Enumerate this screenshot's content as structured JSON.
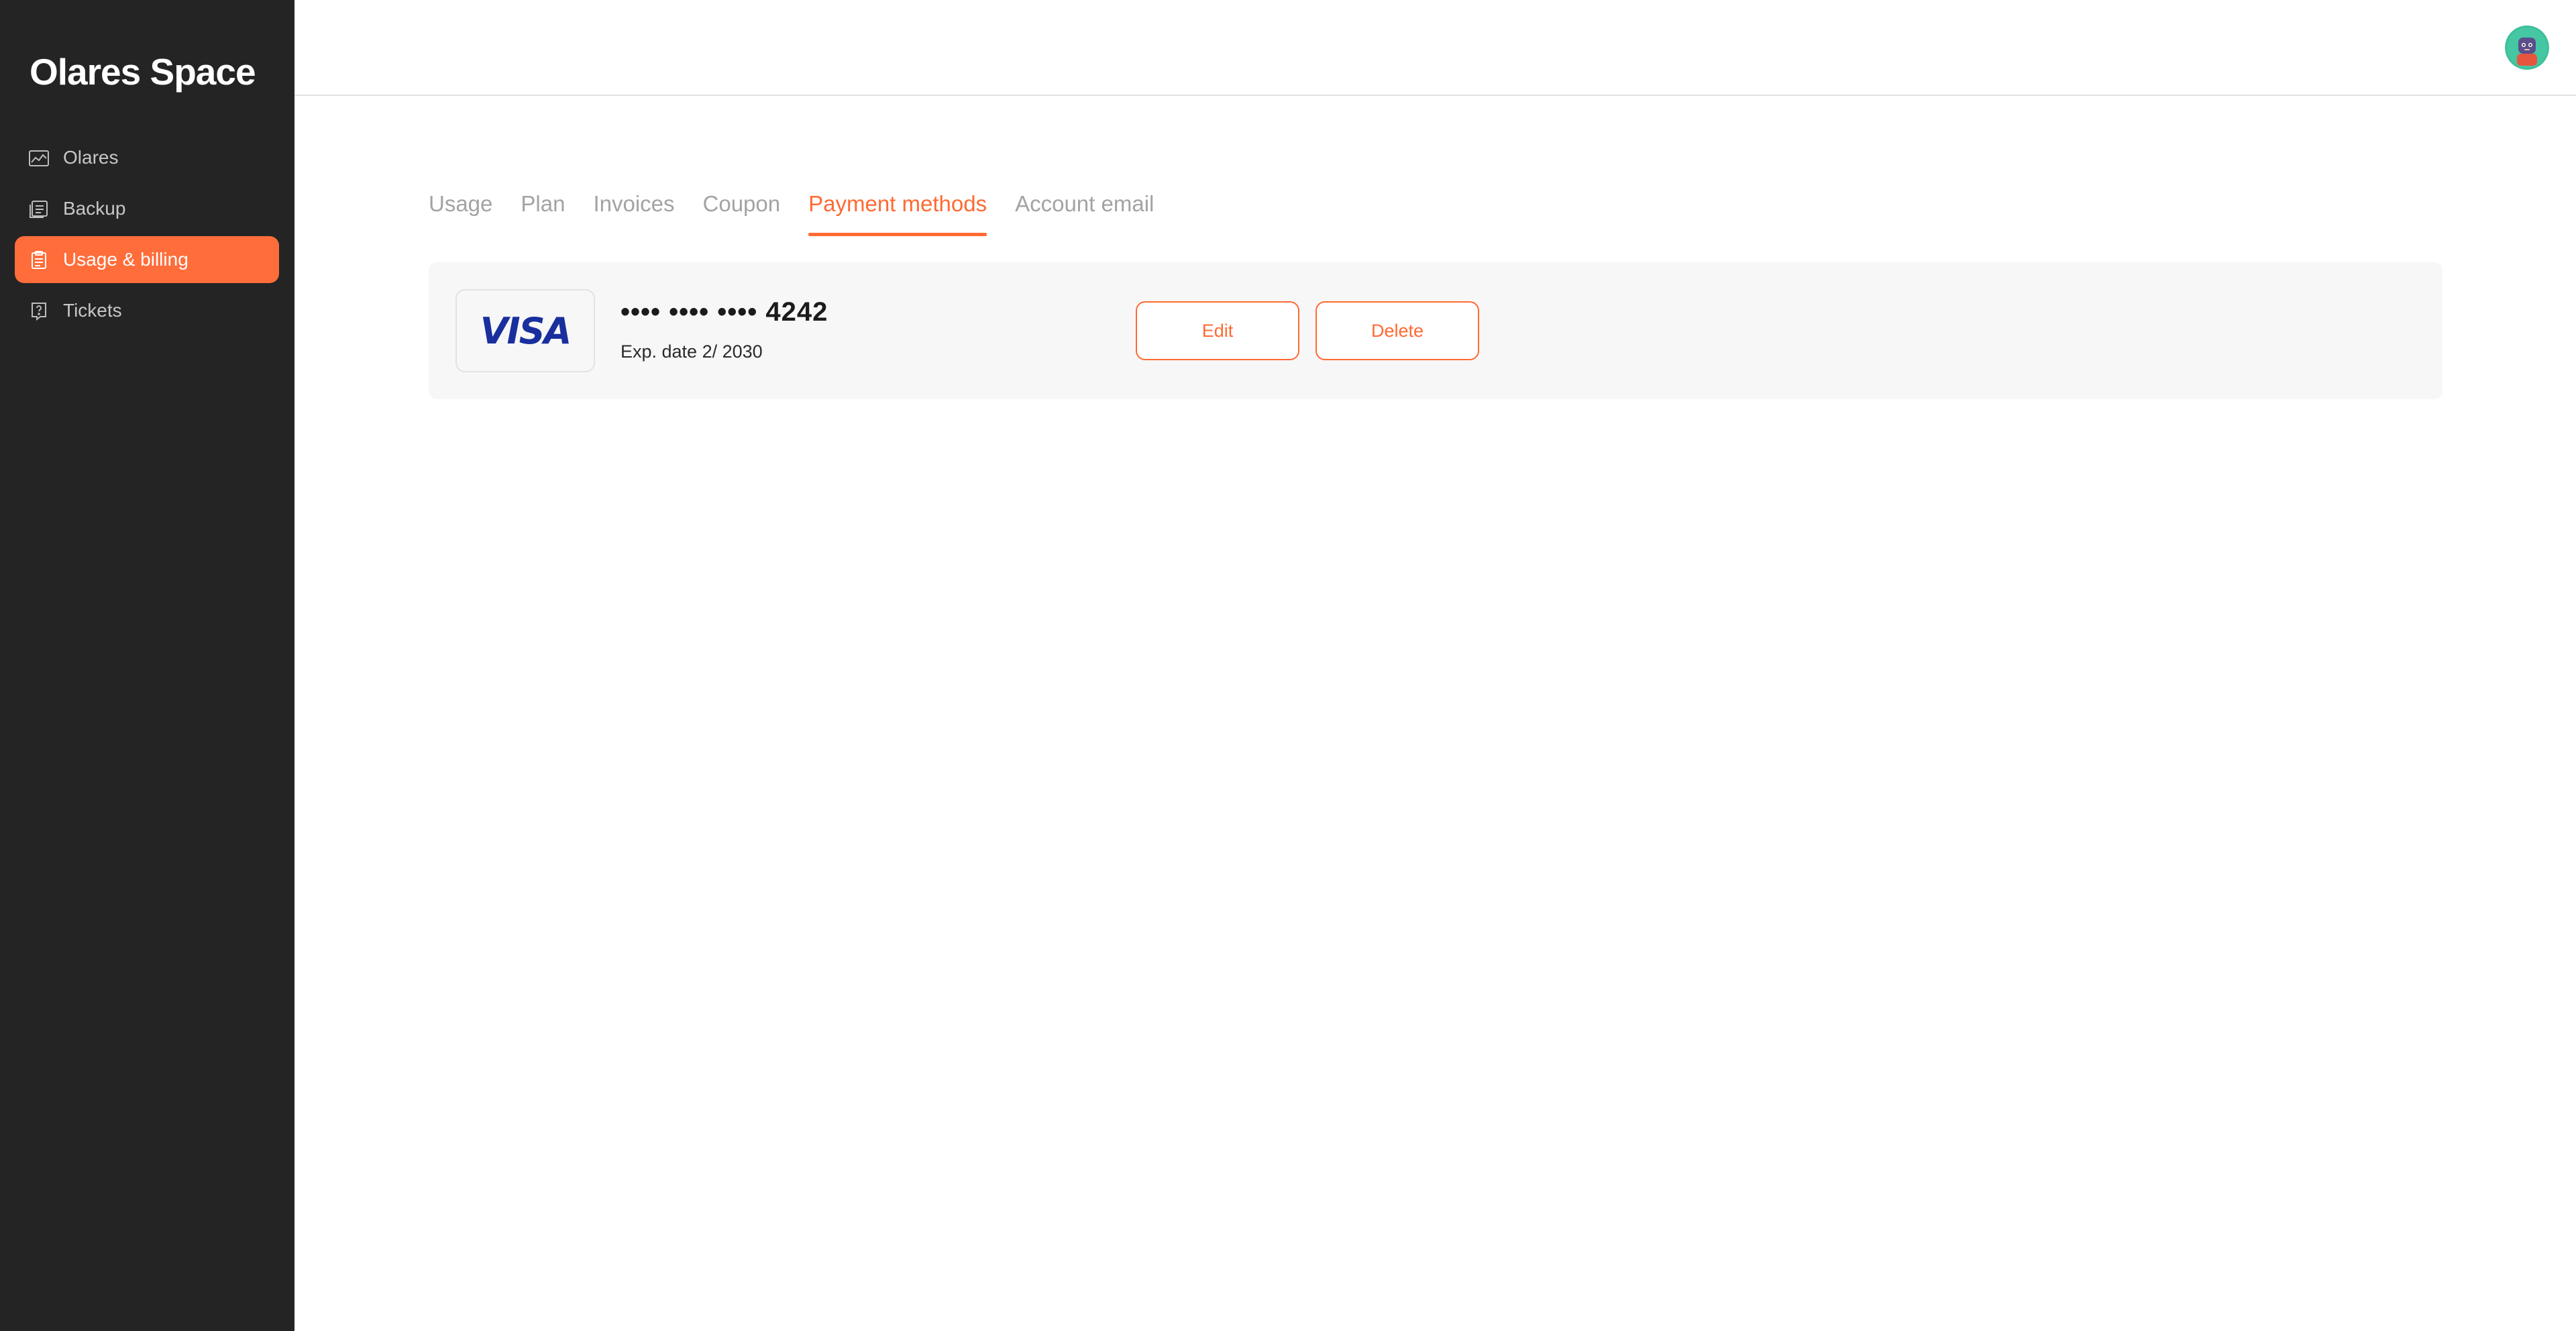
{
  "app": {
    "title": "Olares Space"
  },
  "colors": {
    "accent": "#ff6a33",
    "sidebar_bg": "#242424",
    "active_item_bg": "#ff6d3a",
    "visa_blue": "#1a2f9e"
  },
  "sidebar": {
    "items": [
      {
        "label": "Olares",
        "icon": "chart-icon",
        "active": false
      },
      {
        "label": "Backup",
        "icon": "backup-icon",
        "active": false
      },
      {
        "label": "Usage & billing",
        "icon": "billing-icon",
        "active": true
      },
      {
        "label": "Tickets",
        "icon": "tickets-icon",
        "active": false
      }
    ]
  },
  "header": {
    "avatar": "user-avatar"
  },
  "tabs": [
    {
      "label": "Usage",
      "active": false
    },
    {
      "label": "Plan",
      "active": false
    },
    {
      "label": "Invoices",
      "active": false
    },
    {
      "label": "Coupon",
      "active": false
    },
    {
      "label": "Payment methods",
      "active": true
    },
    {
      "label": "Account email",
      "active": false
    }
  ],
  "payment_method": {
    "brand": "VISA",
    "masked_number": "•••• •••• •••• 4242",
    "expiry": "Exp. date 2/ 2030",
    "edit_label": "Edit",
    "delete_label": "Delete"
  }
}
